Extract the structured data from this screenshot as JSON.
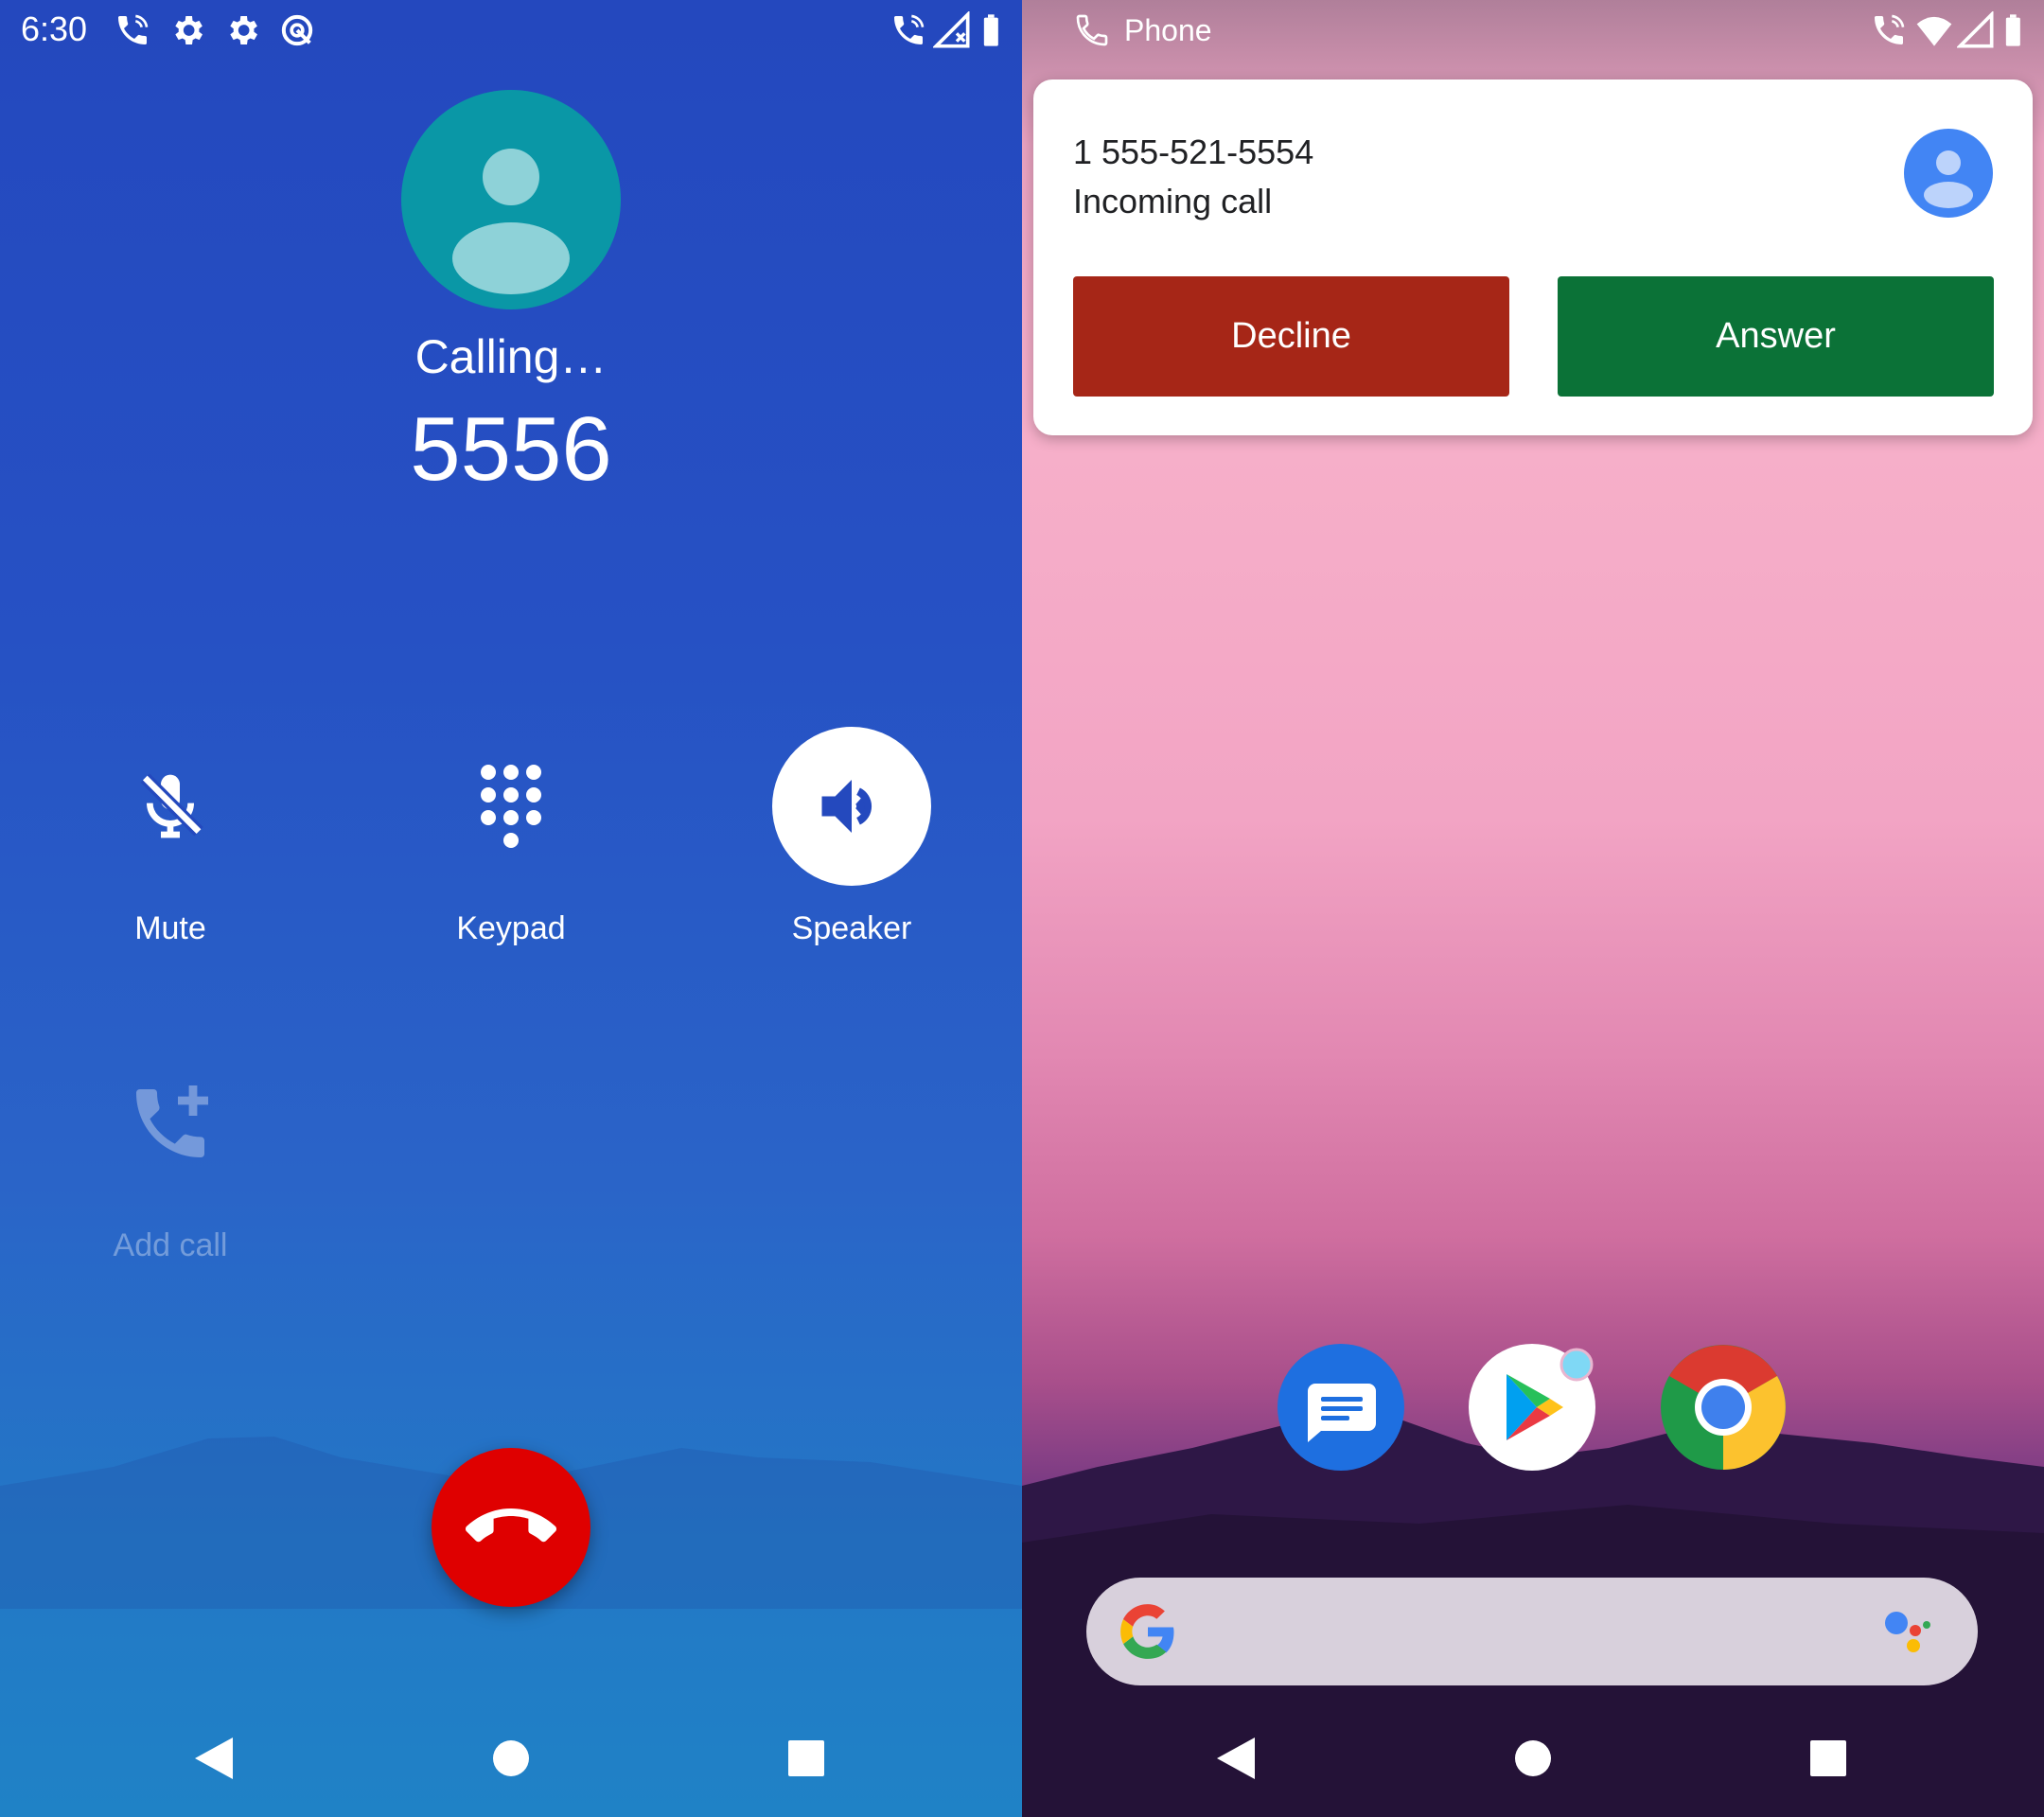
{
  "left_phone": {
    "status_bar": {
      "time": "6:30",
      "left_icons": [
        "wifi-call-icon",
        "gear-icon",
        "gear-icon",
        "data-saver-icon"
      ],
      "right_icons": [
        "wifi-call-icon",
        "signal-no-service-icon",
        "battery-icon"
      ]
    },
    "call": {
      "status": "Calling…",
      "number": "5556"
    },
    "controls": [
      {
        "label": "Mute",
        "icon": "mic-off-icon",
        "enabled": true,
        "active": false
      },
      {
        "label": "Keypad",
        "icon": "dialpad-icon",
        "enabled": true,
        "active": false
      },
      {
        "label": "Speaker",
        "icon": "speaker-icon",
        "enabled": true,
        "active": true
      },
      {
        "label": "Add call",
        "icon": "add-call-icon",
        "enabled": false,
        "active": false
      }
    ],
    "end_call_icon": "call-end-icon",
    "nav": [
      "back-icon",
      "home-icon",
      "recents-icon"
    ],
    "colors": {
      "end_call": "#df0000",
      "avatar": "#0a97a6"
    }
  },
  "right_phone": {
    "status_bar": {
      "app_label": "Phone",
      "right_icons": [
        "wifi-call-icon",
        "wifi-icon",
        "signal-icon",
        "battery-icon"
      ]
    },
    "notification": {
      "number": "1 555-521-5554",
      "subtitle": "Incoming call",
      "decline_label": "Decline",
      "answer_label": "Answer"
    },
    "dock": [
      "messages-icon",
      "play-store-icon",
      "chrome-icon"
    ],
    "search_bar": {
      "logo": "google-g-icon",
      "assistant": "assistant-icon"
    },
    "nav": [
      "back-icon",
      "home-icon",
      "recents-icon"
    ],
    "colors": {
      "decline": "#a62617",
      "answer": "#0b7237"
    }
  }
}
